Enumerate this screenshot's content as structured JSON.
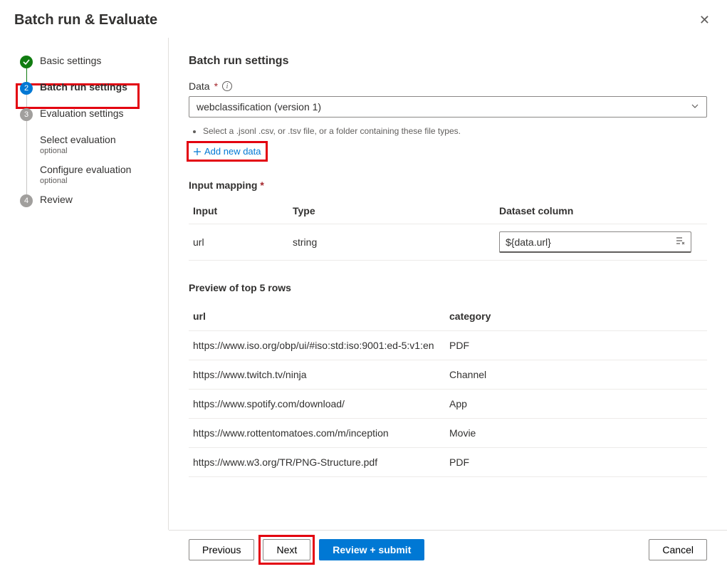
{
  "header": {
    "title": "Batch run & Evaluate"
  },
  "sidebar": {
    "steps": [
      {
        "num": "1",
        "label": "Basic settings",
        "state": "done"
      },
      {
        "num": "2",
        "label": "Batch run settings",
        "state": "active"
      },
      {
        "num": "3",
        "label": "Evaluation settings",
        "state": "future"
      },
      {
        "num": "4",
        "label": "Review",
        "state": "future"
      }
    ],
    "subs": [
      {
        "label": "Select evaluation",
        "optional": "optional"
      },
      {
        "label": "Configure evaluation",
        "optional": "optional"
      }
    ]
  },
  "main": {
    "heading": "Batch run settings",
    "data_label": "Data",
    "data_select_value": "webclassification (version 1)",
    "hint": "Select a .jsonl .csv, or .tsv file, or a folder containing these file types.",
    "add_new": "Add new data",
    "mapping_label": "Input mapping",
    "mapping_headers": {
      "input": "Input",
      "type": "Type",
      "dataset": "Dataset column"
    },
    "mapping_rows": [
      {
        "input": "url",
        "type": "string",
        "dataset": "${data.url}"
      }
    ],
    "preview_label": "Preview of top 5 rows",
    "preview_headers": {
      "url": "url",
      "category": "category"
    },
    "preview_rows": [
      {
        "url": "https://www.iso.org/obp/ui/#iso:std:iso:9001:ed-5:v1:en",
        "category": "PDF"
      },
      {
        "url": "https://www.twitch.tv/ninja",
        "category": "Channel"
      },
      {
        "url": "https://www.spotify.com/download/",
        "category": "App"
      },
      {
        "url": "https://www.rottentomatoes.com/m/inception",
        "category": "Movie"
      },
      {
        "url": "https://www.w3.org/TR/PNG-Structure.pdf",
        "category": "PDF"
      }
    ]
  },
  "footer": {
    "previous": "Previous",
    "next": "Next",
    "review_submit": "Review + submit",
    "cancel": "Cancel"
  }
}
